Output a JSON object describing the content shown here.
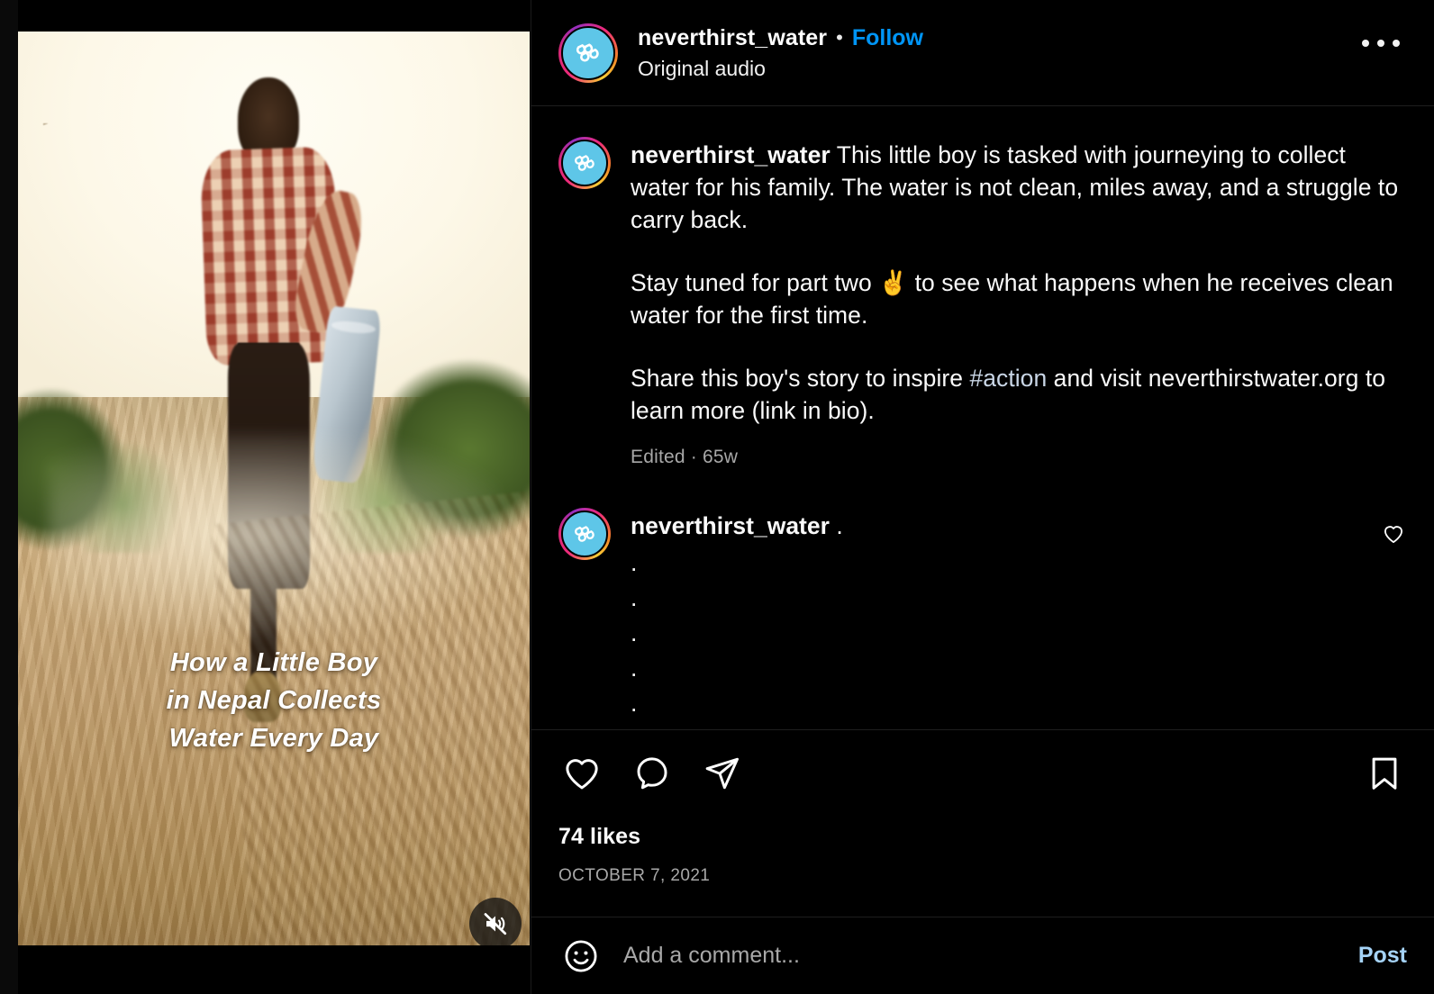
{
  "post": {
    "header": {
      "username": "neverthirst_water",
      "separator": "•",
      "follow_label": "Follow",
      "audio_label": "Original audio",
      "more_icon": "ellipsis-icon"
    },
    "media": {
      "type": "video",
      "overlay_title": "How a Little Boy\nin Nepal Collects\nWater Every Day",
      "mute_icon": "speaker-muted-icon",
      "muted": true
    },
    "caption": {
      "username": "neverthirst_water",
      "paragraph_1": "This little boy is tasked with journeying to collect water for his family. The water is not clean, miles away, and a struggle to carry back.",
      "paragraph_2_before": "Stay tuned for part two ",
      "paragraph_2_emoji": "✌️",
      "paragraph_2_after": " to see what happens when he receives clean water for the first time.",
      "paragraph_3_before": "Share this boy's story to inspire ",
      "paragraph_3_hashtag": "#action",
      "paragraph_3_after": " and visit neverthirstwater.org to learn more (link in bio).",
      "meta": "Edited · 65w"
    },
    "comment": {
      "username": "neverthirst_water",
      "text": ".",
      "dot_lines": ".\n.\n.\n.\n.",
      "like_icon": "heart-outline-icon"
    },
    "actions": {
      "like_icon": "heart-outline-icon",
      "comment_icon": "speech-bubble-icon",
      "share_icon": "paper-plane-icon",
      "save_icon": "bookmark-outline-icon"
    },
    "stats": {
      "likes": "74 likes",
      "date": "OCTOBER 7, 2021"
    },
    "add_comment": {
      "emoji_icon": "smiley-face-icon",
      "placeholder": "Add a comment...",
      "value": "",
      "post_label": "Post"
    },
    "colors": {
      "background": "#000000",
      "text_primary": "#fafafa",
      "text_muted": "#a8a8a8",
      "link_blue": "#0095f6",
      "post_blue": "#a5d3f7",
      "avatar_blue": "#5ec6e8"
    }
  }
}
